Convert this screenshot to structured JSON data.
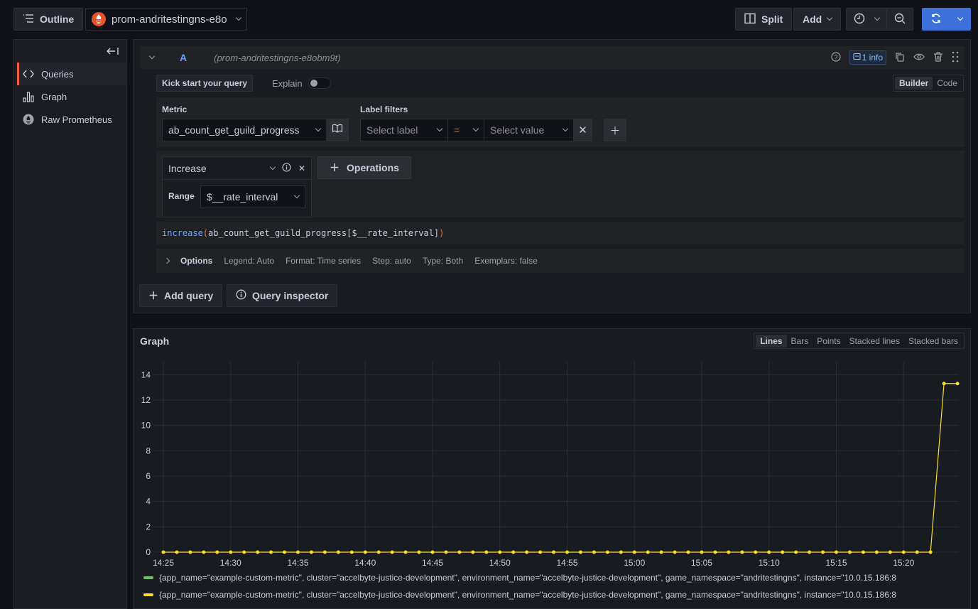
{
  "topbar": {
    "outline_label": "Outline",
    "datasource": "prom-andritestingns-e8o",
    "split_label": "Split",
    "add_label": "Add",
    "run_color": "#3d71d9"
  },
  "sidebar": {
    "items": [
      {
        "label": "Queries",
        "icon": "code-brackets-icon",
        "active": true
      },
      {
        "label": "Graph",
        "icon": "bar-chart-icon",
        "active": false
      },
      {
        "label": "Raw Prometheus",
        "icon": "prometheus-icon",
        "active": false
      }
    ]
  },
  "query": {
    "ref_id": "A",
    "datasource_label": "(prom-andritestingns-e8obm9t)",
    "info_badge": "1 info",
    "kick_start": "Kick start your query",
    "explain_label": "Explain",
    "explain_on": false,
    "modes": [
      "Builder",
      "Code"
    ],
    "active_mode": "Builder",
    "metric_label": "Metric",
    "metric_value": "ab_count_get_guild_progress",
    "label_filters_label": "Label filters",
    "label_placeholder": "Select label",
    "operator": "=",
    "value_placeholder": "Select value",
    "operation": {
      "name": "Increase",
      "param_label": "Range",
      "param_value": "$__rate_interval"
    },
    "operations_button": "Operations",
    "code_fn": "increase",
    "code_open": "(",
    "code_body": "ab_count_get_guild_progress[$__rate_interval]",
    "code_close": ")",
    "options": {
      "title": "Options",
      "legend": "Legend: Auto",
      "format": "Format: Time series",
      "step": "Step: auto",
      "type": "Type: Both",
      "exemplars": "Exemplars: false"
    },
    "add_query": "Add query",
    "query_inspector": "Query inspector"
  },
  "graph": {
    "title": "Graph",
    "viz_types": [
      "Lines",
      "Bars",
      "Points",
      "Stacked lines",
      "Stacked bars"
    ],
    "active_viz": "Lines"
  },
  "chart_data": {
    "type": "line",
    "title": "Graph",
    "xlabel": "",
    "ylabel": "",
    "ylim": [
      0,
      14.8
    ],
    "yticks": [
      0,
      2,
      4,
      6,
      8,
      10,
      12,
      14
    ],
    "xticks": [
      "14:25",
      "14:30",
      "14:35",
      "14:40",
      "14:45",
      "14:50",
      "14:55",
      "15:00",
      "15:05",
      "15:10",
      "15:15",
      "15:20"
    ],
    "x_start": "14:25",
    "x_step_minutes": 1,
    "grid": true,
    "legend_position": "bottom",
    "series": [
      {
        "name": "{app_name=\"example-custom-metric\", cluster=\"accelbyte-justice-development\", environment_name=\"accelbyte-justice-development\", game_namespace=\"andritestingns\", instance=\"10.0.15.186:8",
        "color": "#73bf69",
        "values": []
      },
      {
        "name": "{app_name=\"example-custom-metric\", cluster=\"accelbyte-justice-development\", environment_name=\"accelbyte-justice-development\", game_namespace=\"andritestingns\", instance=\"10.0.15.186:8",
        "color": "#fade2a",
        "values": [
          0,
          0,
          0,
          0,
          0,
          0,
          0,
          0,
          0,
          0,
          0,
          0,
          0,
          0,
          0,
          0,
          0,
          0,
          0,
          0,
          0,
          0,
          0,
          0,
          0,
          0,
          0,
          0,
          0,
          0,
          0,
          0,
          0,
          0,
          0,
          0,
          0,
          0,
          0,
          0,
          0,
          0,
          0,
          0,
          0,
          0,
          0,
          0,
          0,
          0,
          0,
          0,
          0,
          0,
          0,
          0,
          0,
          0,
          13.3,
          13.3
        ]
      }
    ]
  }
}
